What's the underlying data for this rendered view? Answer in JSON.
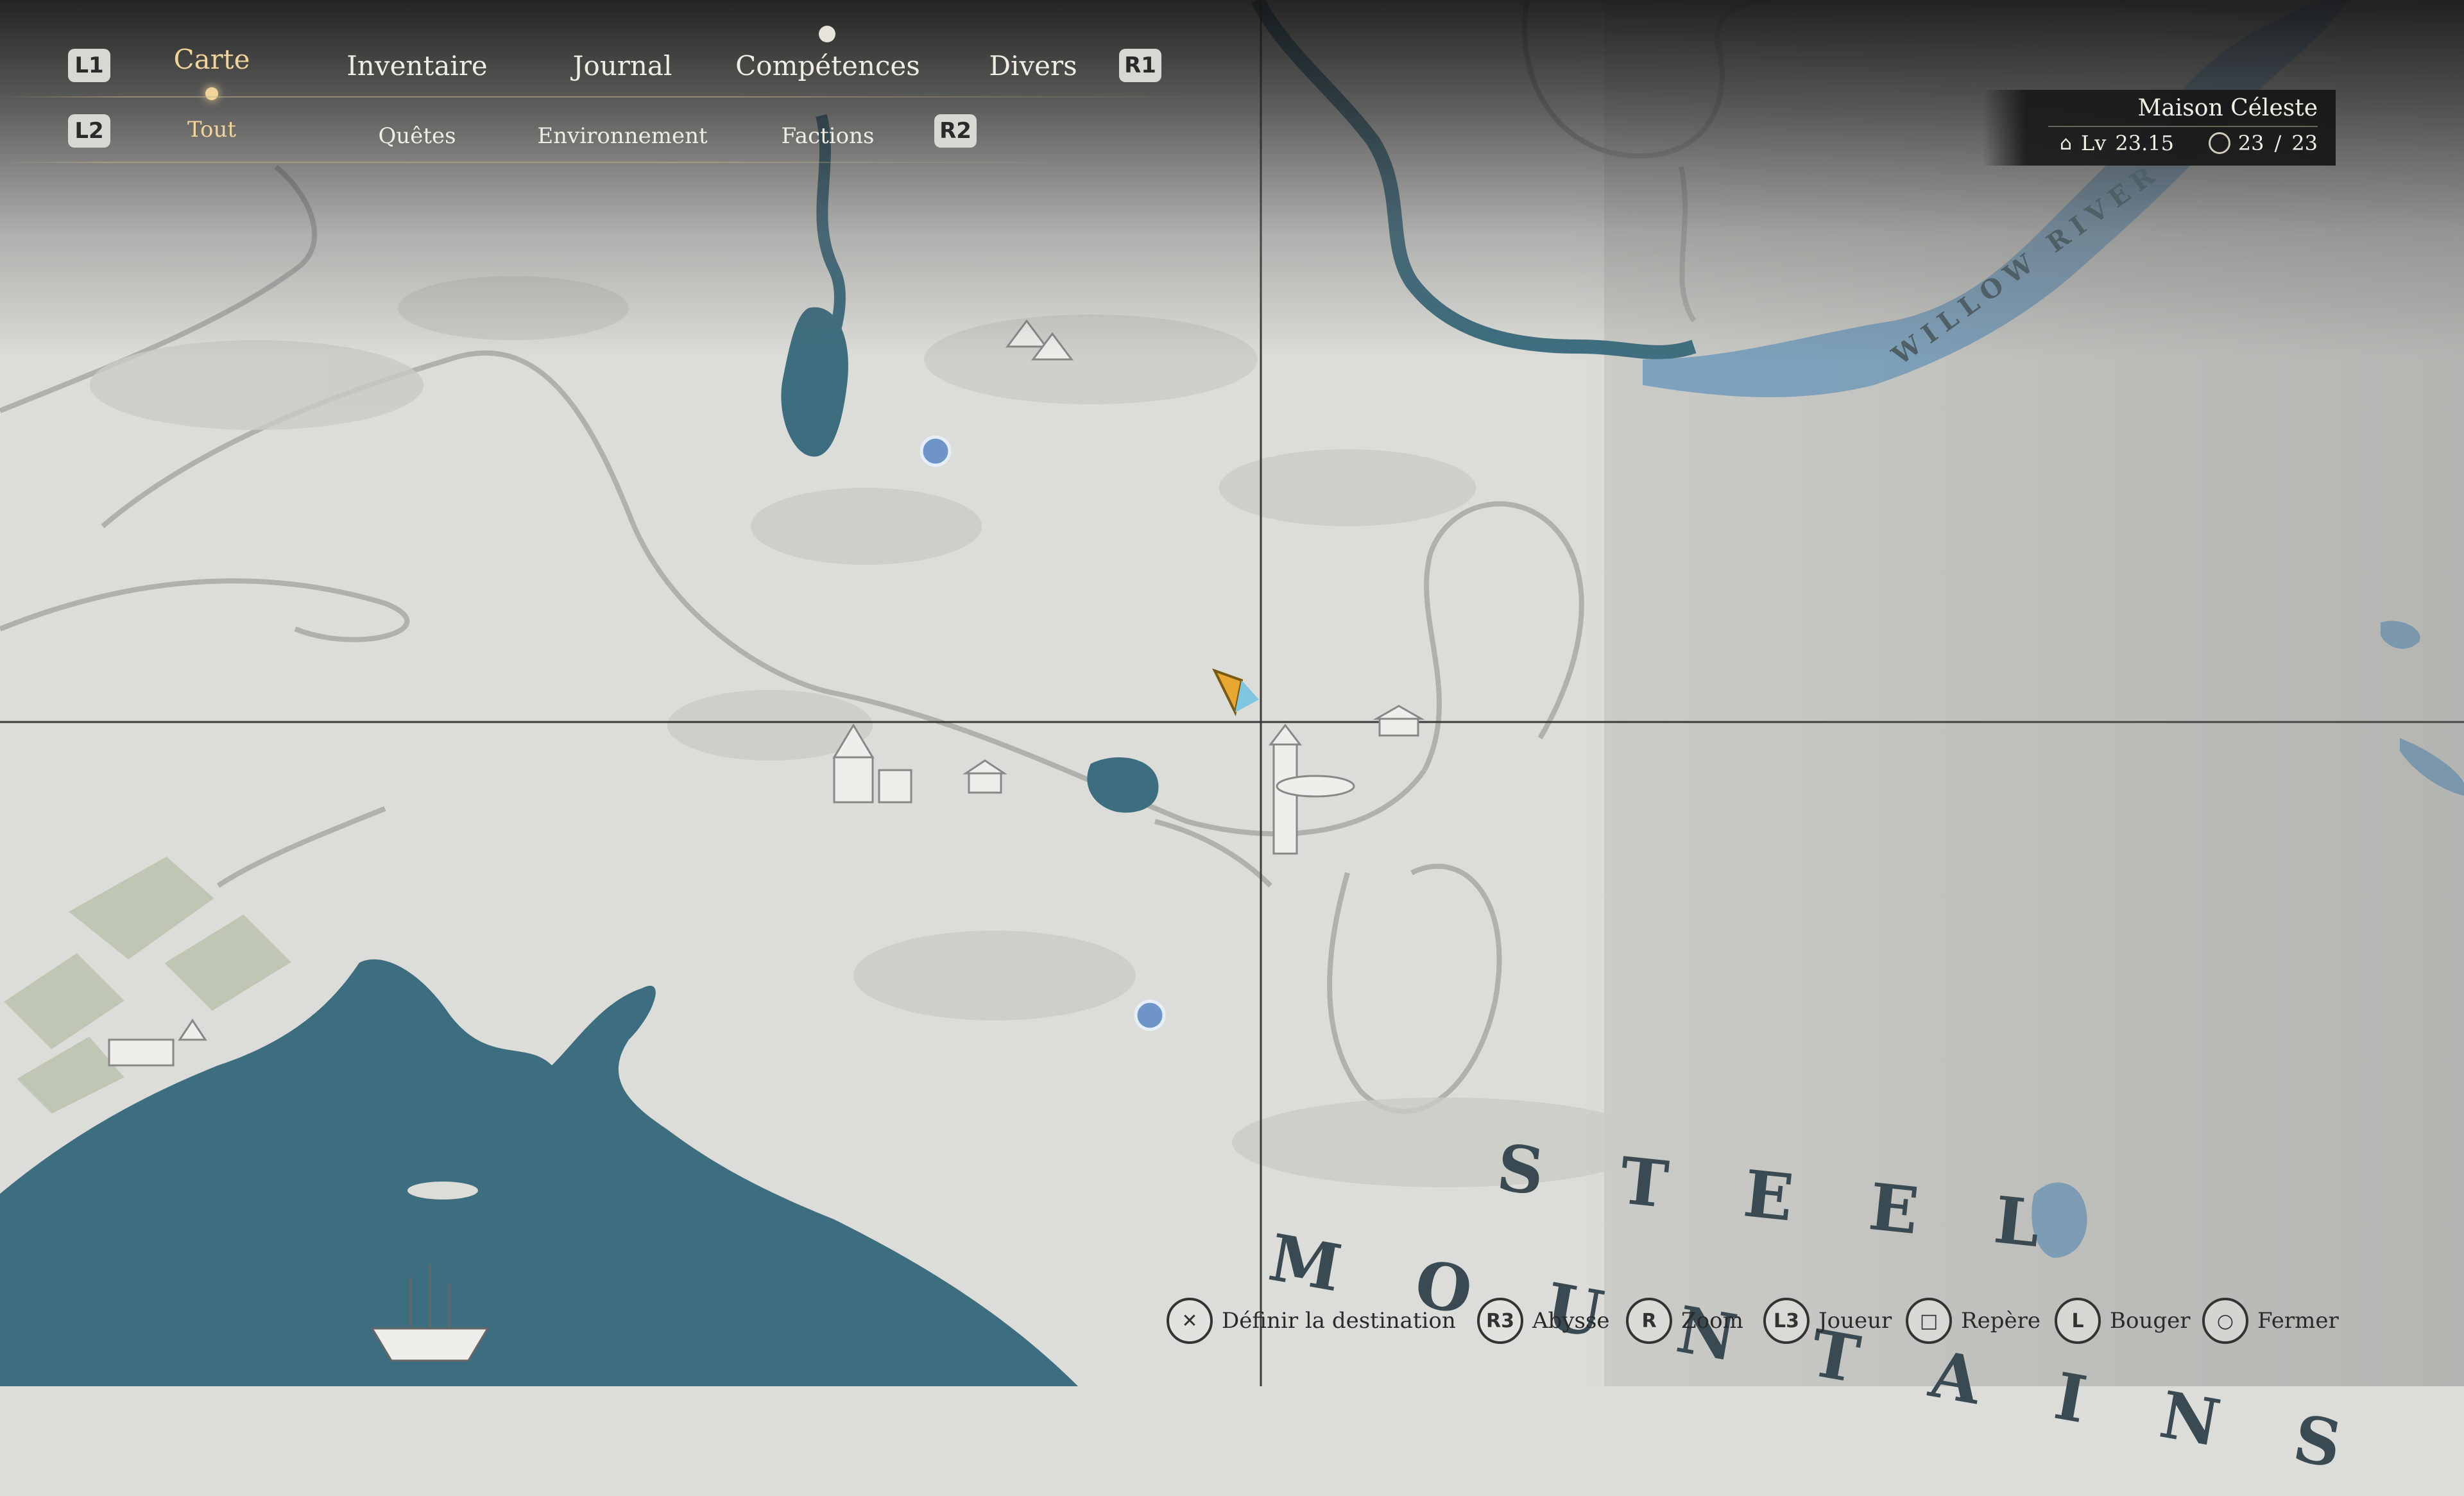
{
  "nav": {
    "bumper_left": "L1",
    "bumper_right": "R1",
    "trigger_left": "L2",
    "trigger_right": "R2",
    "tabs": [
      {
        "label": "Carte",
        "active": true
      },
      {
        "label": "Inventaire",
        "active": false
      },
      {
        "label": "Journal",
        "active": false
      },
      {
        "label": "Compétences",
        "active": false
      },
      {
        "label": "Divers",
        "active": false
      }
    ],
    "subtabs": [
      {
        "label": "Tout",
        "active": true
      },
      {
        "label": "Quêtes",
        "active": false
      },
      {
        "label": "Environnement",
        "active": false
      },
      {
        "label": "Factions",
        "active": false
      }
    ]
  },
  "info": {
    "location": "Maison Céleste",
    "level_label": "Lv",
    "level_value": "23.15",
    "count": "23",
    "count_sep": "/",
    "count_max": "23"
  },
  "map": {
    "river_label": "WILLOW RIVER",
    "region_word1": "STEEL",
    "region_word2": "MOUNTAINS",
    "colors": {
      "land": "#dcdcd8",
      "water": "#3d6e80",
      "light_water": "#7ea4c0",
      "road": "#b4b4b0",
      "player": "#e8a830"
    }
  },
  "controls": [
    {
      "icon": "✕",
      "label": "Définir la destination"
    },
    {
      "icon": "R3",
      "label": "Abysse"
    },
    {
      "icon": "R",
      "label": "Zoom"
    },
    {
      "icon": "L3",
      "label": "Joueur"
    },
    {
      "icon": "□",
      "label": "Repère"
    },
    {
      "icon": "L",
      "label": "Bouger"
    },
    {
      "icon": "○",
      "label": "Fermer"
    }
  ]
}
